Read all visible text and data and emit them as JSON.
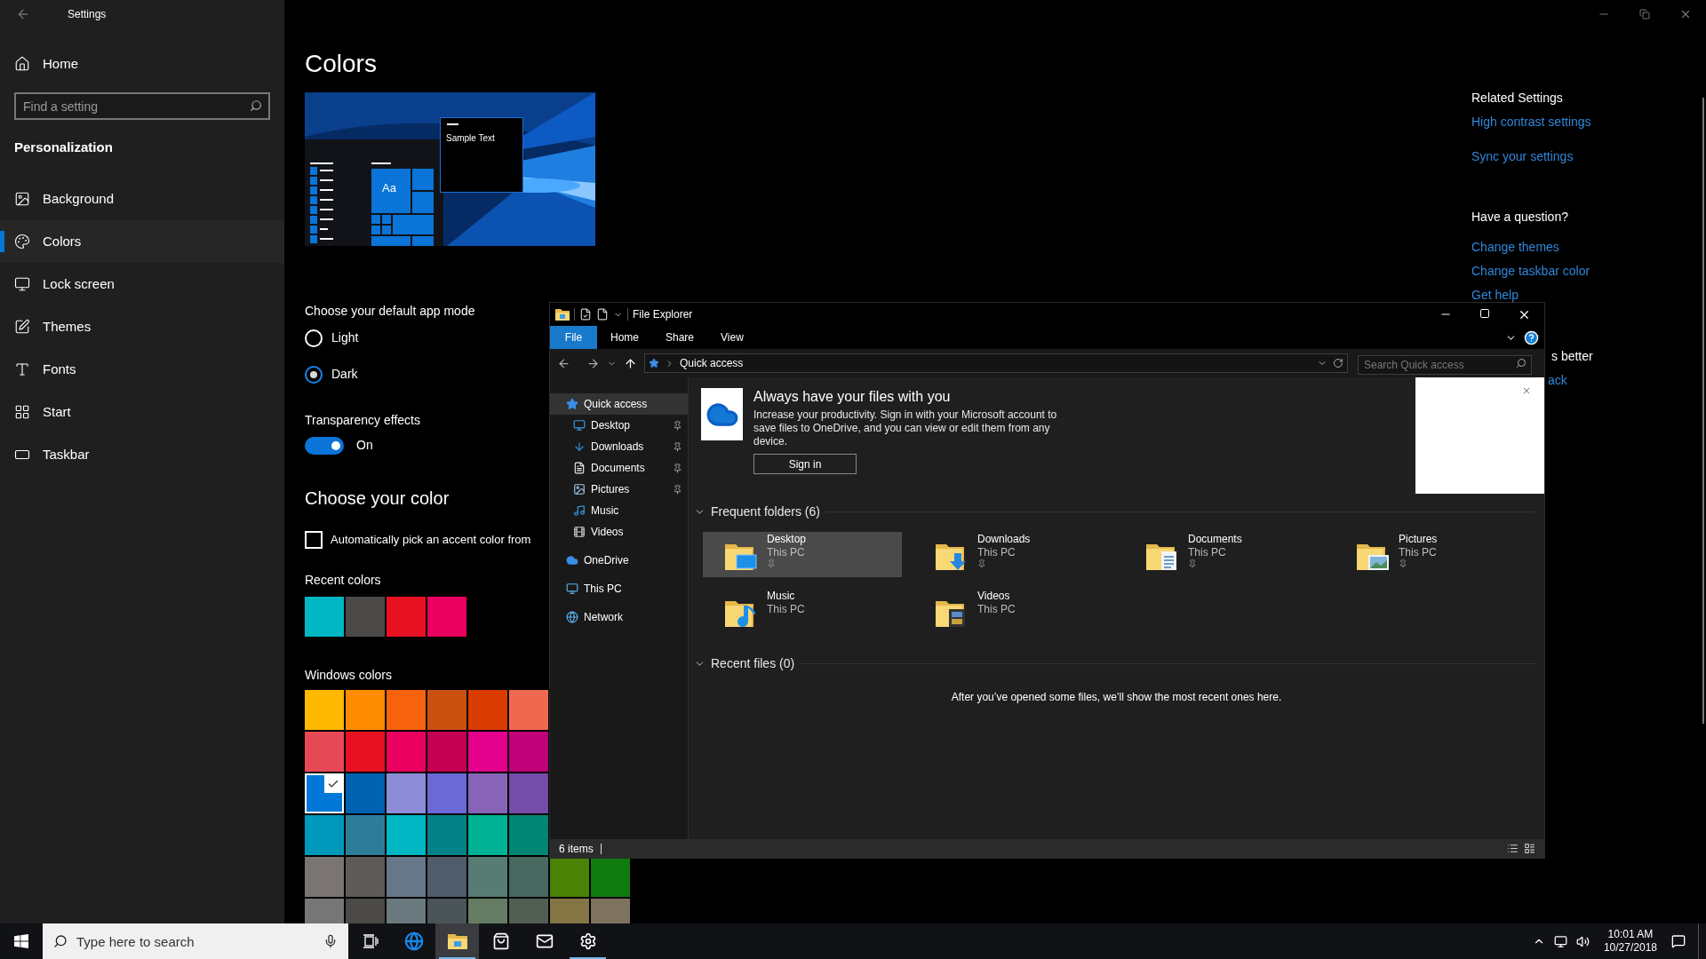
{
  "settings": {
    "title": "Settings",
    "home": "Home",
    "search": {
      "placeholder": "Find a setting"
    },
    "section": "Personalization",
    "nav": [
      {
        "label": "Background",
        "kind": "background",
        "selected": false
      },
      {
        "label": "Colors",
        "kind": "colors",
        "selected": true
      },
      {
        "label": "Lock screen",
        "kind": "lock_screen",
        "selected": false
      },
      {
        "label": "Themes",
        "kind": "themes",
        "selected": false
      },
      {
        "label": "Fonts",
        "kind": "fonts",
        "selected": false
      },
      {
        "label": "Start",
        "kind": "start",
        "selected": false
      },
      {
        "label": "Taskbar",
        "kind": "taskbar",
        "selected": false
      }
    ]
  },
  "page": {
    "title": "Colors",
    "preview": {
      "tile_text": "Aa",
      "sample_text": "Sample Text"
    },
    "app_mode": {
      "label": "Choose your default app mode",
      "options": [
        {
          "label": "Light",
          "selected": false
        },
        {
          "label": "Dark",
          "selected": true
        }
      ]
    },
    "transparency": {
      "label": "Transparency effects",
      "on": true,
      "state_label": "On"
    },
    "color_heading": "Choose your color",
    "auto_accent": {
      "label": "Automatically pick an accent color from",
      "checked": false
    },
    "recent_colors": {
      "label": "Recent colors",
      "swatches": [
        {
          "color": "#00b7c3"
        },
        {
          "color": "#4c4a48"
        },
        {
          "color": "#e81123"
        },
        {
          "color": "#ea005e"
        }
      ]
    },
    "windows_colors": {
      "label": "Windows colors",
      "rows": [
        [
          {
            "color": "#ffb900",
            "selected": false
          },
          {
            "color": "#ff8c00",
            "selected": false
          },
          {
            "color": "#f7630c",
            "selected": false
          },
          {
            "color": "#ca5010",
            "selected": false
          },
          {
            "color": "#da3b01",
            "selected": false
          },
          {
            "color": "#ef6950",
            "selected": false
          }
        ],
        [
          {
            "color": "#e74856",
            "selected": false
          },
          {
            "color": "#e81123",
            "selected": false
          },
          {
            "color": "#ea005e",
            "selected": false
          },
          {
            "color": "#c30052",
            "selected": false
          },
          {
            "color": "#e3008c",
            "selected": false
          },
          {
            "color": "#bf0077",
            "selected": false
          }
        ],
        [
          {
            "color": "#0078d7",
            "selected": true
          },
          {
            "color": "#0063b1",
            "selected": false
          },
          {
            "color": "#8e8cd8",
            "selected": false
          },
          {
            "color": "#6b69d6",
            "selected": false
          },
          {
            "color": "#8764b8",
            "selected": false
          },
          {
            "color": "#744da9",
            "selected": false
          }
        ],
        [
          {
            "color": "#0099bc",
            "selected": false
          },
          {
            "color": "#2d7d9a",
            "selected": false
          },
          {
            "color": "#00b7c3",
            "selected": false
          },
          {
            "color": "#038387",
            "selected": false
          },
          {
            "color": "#00b294",
            "selected": false
          },
          {
            "color": "#018574",
            "selected": false
          }
        ],
        [
          {
            "color": "#7a7574",
            "selected": false
          },
          {
            "color": "#5d5a58",
            "selected": false
          },
          {
            "color": "#68768a",
            "selected": false
          },
          {
            "color": "#515c6b",
            "selected": false
          },
          {
            "color": "#567c73",
            "selected": false
          },
          {
            "color": "#486860",
            "selected": false
          },
          {
            "color": "#498205",
            "selected": false
          },
          {
            "color": "#107c10",
            "selected": false
          }
        ],
        [
          {
            "color": "#767676",
            "selected": false
          },
          {
            "color": "#4c4a48",
            "selected": false
          },
          {
            "color": "#69797e",
            "selected": false
          },
          {
            "color": "#4a5459",
            "selected": false
          },
          {
            "color": "#647c64",
            "selected": false
          },
          {
            "color": "#525e54",
            "selected": false
          },
          {
            "color": "#847545",
            "selected": false
          },
          {
            "color": "#7e735f",
            "selected": false
          }
        ]
      ]
    }
  },
  "related": {
    "title": "Related Settings",
    "links": [
      "High contrast settings",
      "Sync your settings"
    ],
    "question_title": "Have a question?",
    "question_links": [
      "Change themes",
      "Change taskbar color",
      "Get help"
    ],
    "feedback_title_fragment": "s better",
    "feedback_link_fragment": "ack"
  },
  "explorer": {
    "title": "File Explorer",
    "ribbon_tabs": [
      {
        "label": "File",
        "kind": "menu"
      },
      {
        "label": "Home",
        "kind": "tab"
      },
      {
        "label": "Share",
        "kind": "tab"
      },
      {
        "label": "View",
        "kind": "tab"
      }
    ],
    "address": "Quick access",
    "search": {
      "placeholder": "Search Quick access"
    },
    "nav": [
      {
        "label": "Quick access",
        "kind": "star",
        "selected": true,
        "children": [
          {
            "label": "Desktop",
            "kind": "desktop",
            "pinned": true,
            "selected": false
          },
          {
            "label": "Downloads",
            "kind": "downloads",
            "pinned": true,
            "selected": false
          },
          {
            "label": "Documents",
            "kind": "documents",
            "pinned": true,
            "selected": false
          },
          {
            "label": "Pictures",
            "kind": "pictures",
            "pinned": true,
            "selected": false
          },
          {
            "label": "Music",
            "kind": "music",
            "pinned": false,
            "selected": false
          },
          {
            "label": "Videos",
            "kind": "videos",
            "pinned": false,
            "selected": false
          }
        ]
      },
      {
        "label": "OneDrive",
        "kind": "cloud",
        "selected": false
      },
      {
        "label": "This PC",
        "kind": "pc",
        "selected": false
      },
      {
        "label": "Network",
        "kind": "network",
        "selected": false
      }
    ],
    "banner": {
      "title": "Always have your files with you",
      "text": "Increase your productivity. Sign in with your Microsoft account to save files to OneDrive, and you can view or edit them from any device.",
      "button": "Sign in"
    },
    "frequent": {
      "heading": "Frequent folders (6)",
      "expanded": true,
      "folders": [
        {
          "name": "Desktop",
          "location": "This PC",
          "kind": "desktop",
          "pinned": true,
          "selected": true
        },
        {
          "name": "Downloads",
          "location": "This PC",
          "kind": "downloads",
          "pinned": true,
          "selected": false
        },
        {
          "name": "Documents",
          "location": "This PC",
          "kind": "documents",
          "pinned": true,
          "selected": false
        },
        {
          "name": "Pictures",
          "location": "This PC",
          "kind": "pictures",
          "pinned": true,
          "selected": false
        },
        {
          "name": "Music",
          "location": "This PC",
          "kind": "music",
          "pinned": false,
          "selected": false
        },
        {
          "name": "Videos",
          "location": "This PC",
          "kind": "videos",
          "pinned": false,
          "selected": false
        }
      ]
    },
    "recent": {
      "heading": "Recent files (0)",
      "expanded": true,
      "empty_text": "After you’ve opened some files, we’ll show the most recent ones here."
    },
    "status": "6 items"
  },
  "taskbar": {
    "search_placeholder": "Type here to search",
    "apps": [
      {
        "kind": "task_view",
        "active": false,
        "running": false
      },
      {
        "kind": "browser",
        "active": false,
        "running": false
      },
      {
        "kind": "explorer",
        "active": true,
        "running": true
      },
      {
        "kind": "store",
        "active": false,
        "running": false
      },
      {
        "kind": "mail",
        "active": false,
        "running": false
      },
      {
        "kind": "settings",
        "active": false,
        "running": true
      }
    ],
    "time": "10:01 AM",
    "date": "10/27/2018"
  }
}
